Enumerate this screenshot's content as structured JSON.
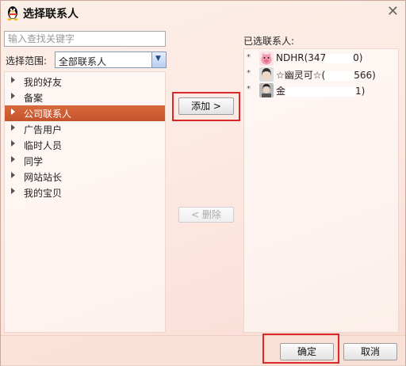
{
  "window": {
    "title": "选择联系人",
    "close_glyph": "✕"
  },
  "search": {
    "placeholder": "输入查找关键字",
    "value": ""
  },
  "range": {
    "label": "选择范围:",
    "selected": "全部联系人",
    "dropdown_glyph": "▼"
  },
  "groups": [
    {
      "label": "我的好友",
      "selected": false
    },
    {
      "label": "备案",
      "selected": false
    },
    {
      "label": "公司联系人",
      "selected": true
    },
    {
      "label": "广告用户",
      "selected": false
    },
    {
      "label": "临时人员",
      "selected": false
    },
    {
      "label": "同学",
      "selected": false
    },
    {
      "label": "网站站长",
      "selected": false
    },
    {
      "label": "我的宝贝",
      "selected": false
    }
  ],
  "buttons": {
    "add": "添加 >",
    "remove": "< 删除",
    "ok": "确定",
    "cancel": "取消"
  },
  "selected_contacts": {
    "label": "已选联系人:",
    "items": [
      {
        "marker": "*",
        "name": "NDHR(347",
        "suffix": "0)",
        "avatar": "pig-avatar-icon"
      },
      {
        "marker": "*",
        "name": "☆幽灵可☆(",
        "suffix": "566)",
        "avatar": "girl-avatar-icon"
      },
      {
        "marker": "*",
        "name": "金",
        "suffix": "1)",
        "avatar": "portrait-avatar-icon"
      }
    ]
  },
  "colors": {
    "selection": "#c4532a",
    "highlight_box": "#d8282a",
    "background": "#fbefe8"
  }
}
